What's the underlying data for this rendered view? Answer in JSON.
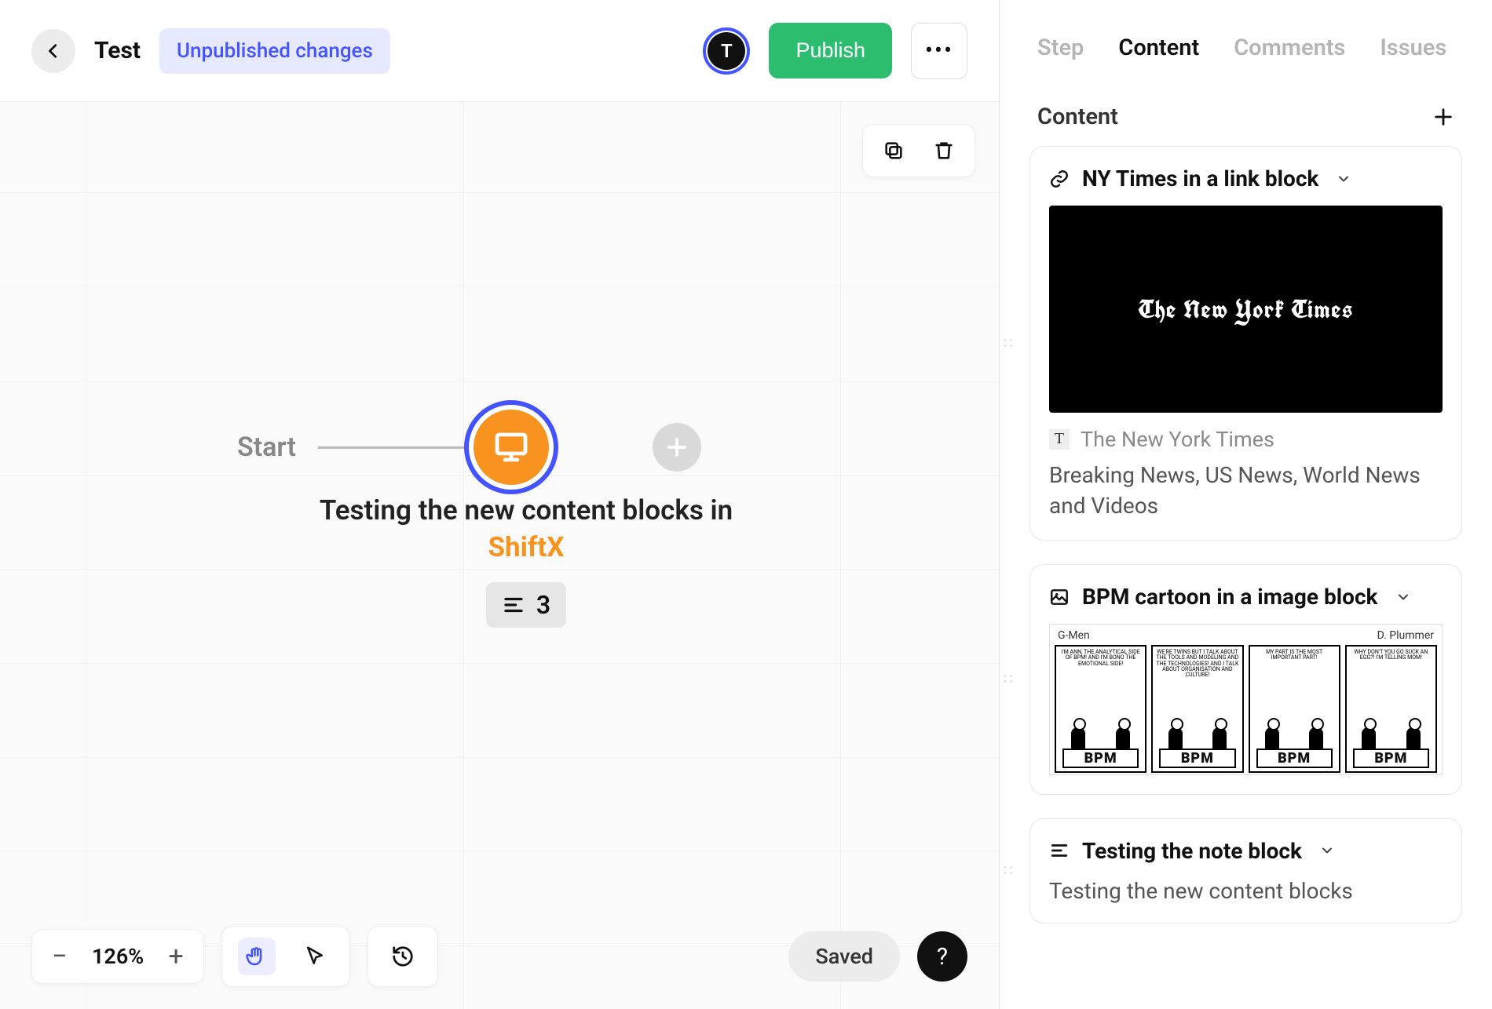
{
  "header": {
    "title": "Test",
    "status_badge": "Unpublished changes",
    "avatar_initial": "T",
    "publish_label": "Publish"
  },
  "canvas": {
    "start_label": "Start",
    "node_caption_line1": "Testing the new content blocks in",
    "node_caption_line2": "ShiftX",
    "content_count": "3"
  },
  "bottombar": {
    "zoom_percent": "126%",
    "saved_label": "Saved",
    "help_label": "?"
  },
  "sidebar": {
    "tabs": {
      "step": "Step",
      "content": "Content",
      "comments": "Comments",
      "issues": "Issues"
    },
    "section_title": "Content",
    "cards": {
      "link": {
        "title": "NY Times in a link block",
        "preview_logo_text": "The New York Times",
        "site_name": "The New York Times",
        "favicon_char": "T",
        "description": "Breaking News, US News, World News and Videos"
      },
      "image": {
        "title": "BPM cartoon in a image block",
        "comic_label_left": "G-Men",
        "comic_label_right": "D. Plummer",
        "panels": [
          {
            "bubble_left": "I'm Ann, the analytical side of BPM!",
            "bubble_right": "And I'm Bono the emotional side!",
            "sign": "BPM"
          },
          {
            "bubble_left": "We're twins but I talk about the tools and modeling and the technologies!",
            "bubble_right": "And I talk about organisation and culture!",
            "sign": "BPM"
          },
          {
            "bubble_left": "My part is the most important part!",
            "bubble_right": "",
            "sign": "BPM"
          },
          {
            "bubble_left": "Why don't you go suck an egg?!",
            "bubble_right": "I'm telling mom!",
            "sign": "BPM"
          }
        ]
      },
      "note": {
        "title": "Testing the note block",
        "body": "Testing the new content blocks"
      }
    }
  }
}
